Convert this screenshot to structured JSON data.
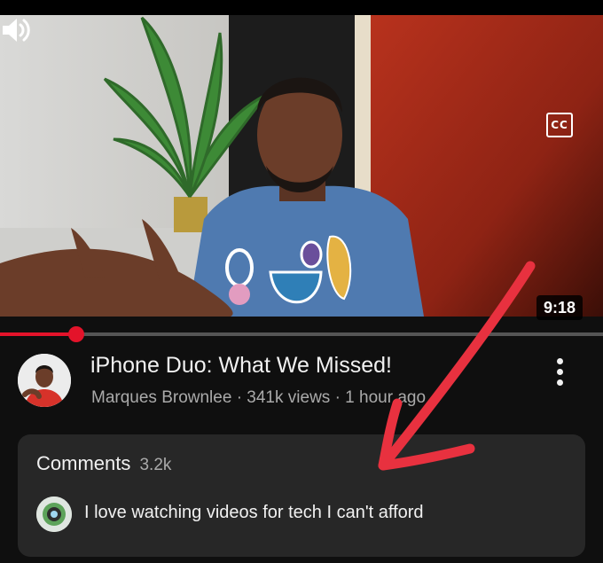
{
  "video": {
    "duration": "9:18",
    "progress_fraction": 0.127,
    "volume_icon": "volume-icon",
    "captions_icon": "closed-captions-icon",
    "captions_label": "CC"
  },
  "details": {
    "title": "iPhone Duo: What We Missed!",
    "meta": "Marques Brownlee · 341k views · 1 hour ago",
    "more_icon": "more-vertical-icon"
  },
  "comments": {
    "label": "Comments",
    "count": "3.2k",
    "top_comment": "I love watching videos for tech I can't afford"
  },
  "colors": {
    "background": "#0f0f0f",
    "card": "#272727",
    "progress": "#e3132a",
    "annotation": "#e8313f"
  }
}
